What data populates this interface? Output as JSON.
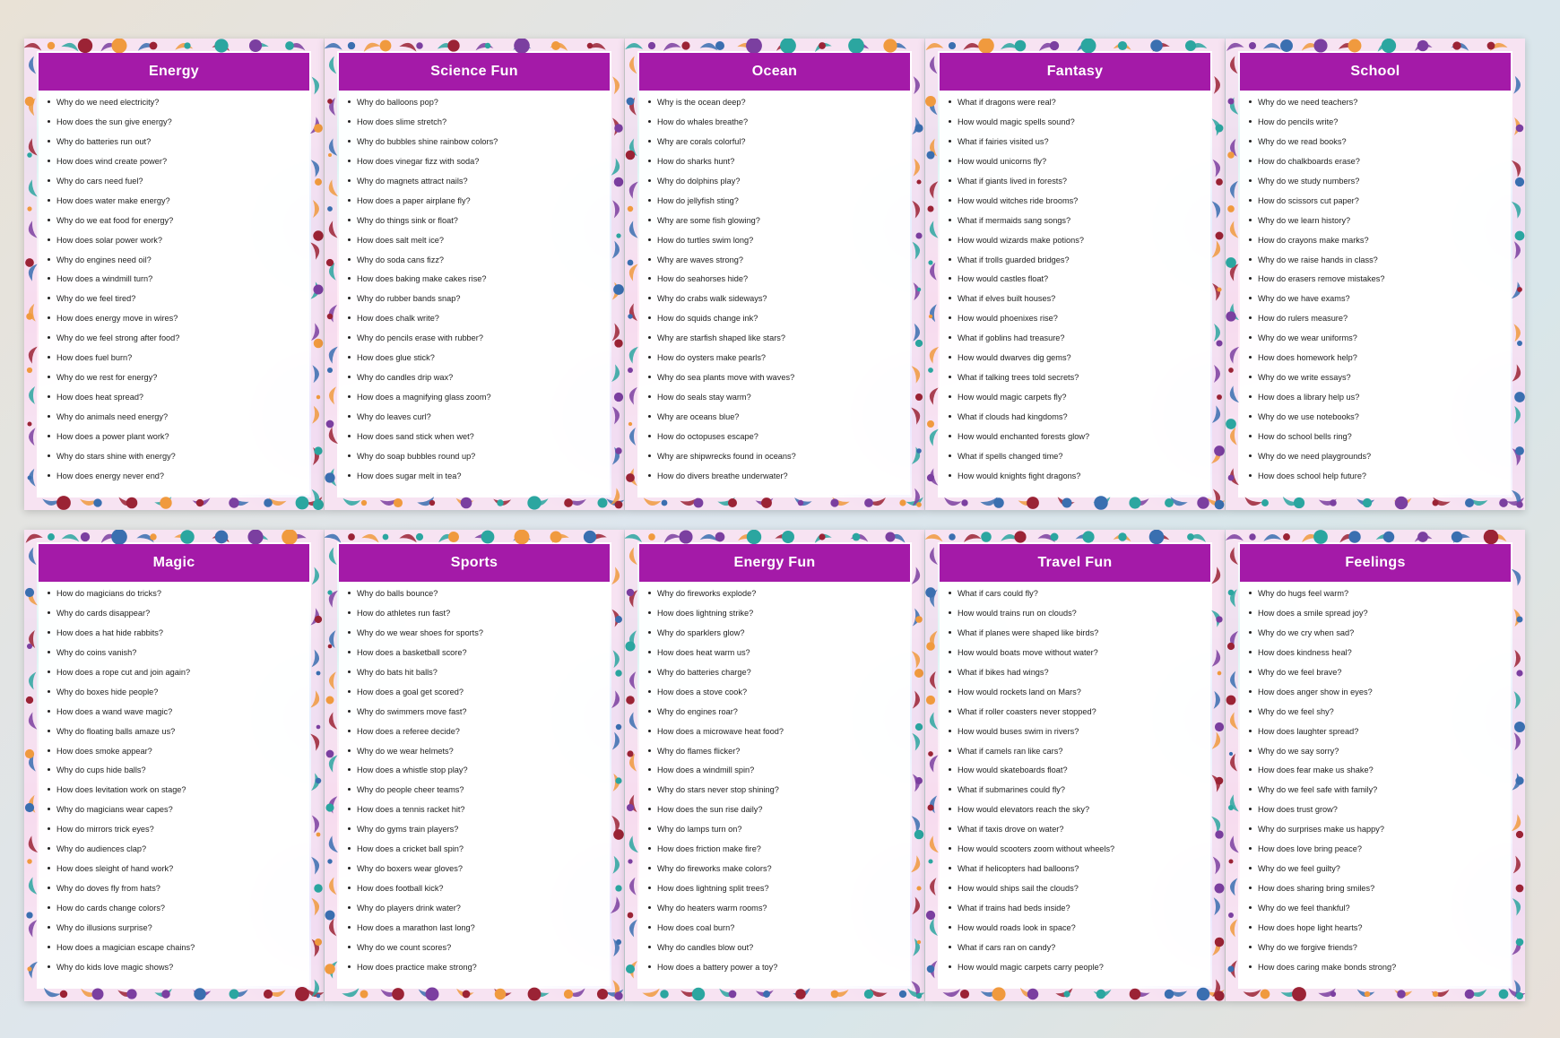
{
  "colors": {
    "header": "#a41aa8",
    "dot_red": "#9b2335",
    "dot_blue": "#3a6fb0",
    "dot_teal": "#2ba6a0",
    "dot_orange": "#f09a3e",
    "dot_purple": "#7b3fa0"
  },
  "cards": [
    {
      "title": "Energy",
      "items": [
        "Why do we need electricity?",
        "How does the sun give energy?",
        "Why do batteries run out?",
        "How does wind create power?",
        "Why do cars need fuel?",
        "How does water make energy?",
        "Why do we eat food for energy?",
        "How does solar power work?",
        "Why do engines need oil?",
        "How does a windmill turn?",
        "Why do we feel tired?",
        "How does energy move in wires?",
        "Why do we feel strong after food?",
        "How does fuel burn?",
        "Why do we rest for energy?",
        "How does heat spread?",
        "Why do animals need energy?",
        "How does a power plant work?",
        "Why do stars shine with energy?",
        "How does energy never end?"
      ]
    },
    {
      "title": "Science Fun",
      "items": [
        "Why do balloons pop?",
        "How does slime stretch?",
        "Why do bubbles shine rainbow colors?",
        "How does vinegar fizz with soda?",
        "Why do magnets attract nails?",
        "How does a paper airplane fly?",
        "Why do things sink or float?",
        "How does salt melt ice?",
        "Why do soda cans fizz?",
        "How does baking make cakes rise?",
        "Why do rubber bands snap?",
        "How does chalk write?",
        "Why do pencils erase with rubber?",
        "How does glue stick?",
        "Why do candles drip wax?",
        "How does a magnifying glass zoom?",
        "Why do leaves curl?",
        "How does sand stick when wet?",
        "Why do soap bubbles round up?",
        "How does sugar melt in tea?"
      ]
    },
    {
      "title": "Ocean",
      "items": [
        "Why is the ocean deep?",
        "How do whales breathe?",
        "Why are corals colorful?",
        "How do sharks hunt?",
        "Why do dolphins play?",
        "How do jellyfish sting?",
        "Why are some fish glowing?",
        "How do turtles swim long?",
        "Why are waves strong?",
        "How do seahorses hide?",
        "Why do crabs walk sideways?",
        "How do squids change ink?",
        "Why are starfish shaped like stars?",
        "How do oysters make pearls?",
        "Why do sea plants move with waves?",
        "How do seals stay warm?",
        "Why are oceans blue?",
        "How do octopuses escape?",
        "Why are shipwrecks found in oceans?",
        "How do divers breathe underwater?"
      ]
    },
    {
      "title": "Fantasy",
      "items": [
        "What if dragons were real?",
        "How would magic spells sound?",
        "What if fairies visited us?",
        "How would unicorns fly?",
        "What if giants lived in forests?",
        "How would witches ride brooms?",
        "What if mermaids sang songs?",
        "How would wizards make potions?",
        "What if trolls guarded bridges?",
        "How would castles float?",
        "What if elves built houses?",
        "How would phoenixes rise?",
        "What if goblins had treasure?",
        "How would dwarves dig gems?",
        "What if talking trees told secrets?",
        "How would magic carpets fly?",
        "What if clouds had kingdoms?",
        "How would enchanted forests glow?",
        "What if spells changed time?",
        "How would knights fight dragons?"
      ]
    },
    {
      "title": "School",
      "items": [
        "Why do we need teachers?",
        "How do pencils write?",
        "Why do we read books?",
        "How do chalkboards erase?",
        "Why do we study numbers?",
        "How do scissors cut paper?",
        "Why do we learn history?",
        "How do crayons make marks?",
        "Why do we raise hands in class?",
        "How do erasers remove mistakes?",
        "Why do we have exams?",
        "How do rulers measure?",
        "Why do we wear uniforms?",
        "How does homework help?",
        "Why do we write essays?",
        "How does a library help us?",
        "Why do we use notebooks?",
        "How do school bells ring?",
        "Why do we need playgrounds?",
        "How does school help future?"
      ]
    },
    {
      "title": "Magic",
      "items": [
        "How do magicians do tricks?",
        "Why do cards disappear?",
        "How does a hat hide rabbits?",
        "Why do coins vanish?",
        "How does a rope cut and join again?",
        "Why do boxes hide people?",
        "How does a wand wave magic?",
        "Why do floating balls amaze us?",
        "How does smoke appear?",
        "Why do cups hide balls?",
        "How does levitation work on stage?",
        "Why do magicians wear capes?",
        "How do mirrors trick eyes?",
        "Why do audiences clap?",
        "How does sleight of hand work?",
        "Why do doves fly from hats?",
        "How do cards change colors?",
        "Why do illusions surprise?",
        "How does a magician escape chains?",
        "Why do kids love magic shows?"
      ]
    },
    {
      "title": "Sports",
      "items": [
        "Why do balls bounce?",
        "How do athletes run fast?",
        "Why do we wear shoes for sports?",
        "How does a basketball score?",
        "Why do bats hit balls?",
        "How does a goal get scored?",
        "Why do swimmers move fast?",
        "How does a referee decide?",
        "Why do we wear helmets?",
        "How does a whistle stop play?",
        "Why do people cheer teams?",
        "How does a tennis racket hit?",
        "Why do gyms train players?",
        "How does a cricket ball spin?",
        "Why do boxers wear gloves?",
        "How does football kick?",
        "Why do players drink water?",
        "How does a marathon last long?",
        "Why do we count scores?",
        "How does practice make strong?"
      ]
    },
    {
      "title": "Energy Fun",
      "items": [
        "Why do fireworks explode?",
        "How does lightning strike?",
        "Why do sparklers glow?",
        "How does heat warm us?",
        "Why do batteries charge?",
        "How does a stove cook?",
        "Why do engines roar?",
        "How does a microwave heat food?",
        "Why do flames flicker?",
        "How does a windmill spin?",
        "Why do stars never stop shining?",
        "How does the sun rise daily?",
        "Why do lamps turn on?",
        "How does friction make fire?",
        "Why do fireworks make colors?",
        "How does lightning split trees?",
        "Why do heaters warm rooms?",
        "How does coal burn?",
        "Why do candles blow out?",
        "How does a battery power a toy?"
      ]
    },
    {
      "title": "Travel Fun",
      "items": [
        "What if cars could fly?",
        "How would trains run on clouds?",
        "What if planes were shaped like birds?",
        "How would boats move without water?",
        "What if bikes had wings?",
        "How would rockets land on Mars?",
        "What if roller coasters never stopped?",
        "How would buses swim in rivers?",
        "What if camels ran like cars?",
        "How would skateboards float?",
        "What if submarines could fly?",
        "How would elevators reach the sky?",
        "What if taxis drove on water?",
        "How would scooters zoom without wheels?",
        "What if helicopters had balloons?",
        "How would ships sail the clouds?",
        "What if trains had beds inside?",
        "How would roads look in space?",
        "What if cars ran on candy?",
        "How would magic carpets carry people?"
      ]
    },
    {
      "title": "Feelings",
      "items": [
        "Why do hugs feel warm?",
        "How does a smile spread joy?",
        "Why do we cry when sad?",
        "How does kindness heal?",
        "Why do we feel brave?",
        "How does anger show in eyes?",
        "Why do we feel shy?",
        "How does laughter spread?",
        "Why do we say sorry?",
        "How does fear make us shake?",
        "Why do we feel safe with family?",
        "How does trust grow?",
        "Why do surprises make us happy?",
        "How does love bring peace?",
        "Why do we feel guilty?",
        "How does sharing bring smiles?",
        "Why do we feel thankful?",
        "How does hope light hearts?",
        "Why do we forgive friends?",
        "How does caring make bonds strong?"
      ]
    }
  ]
}
